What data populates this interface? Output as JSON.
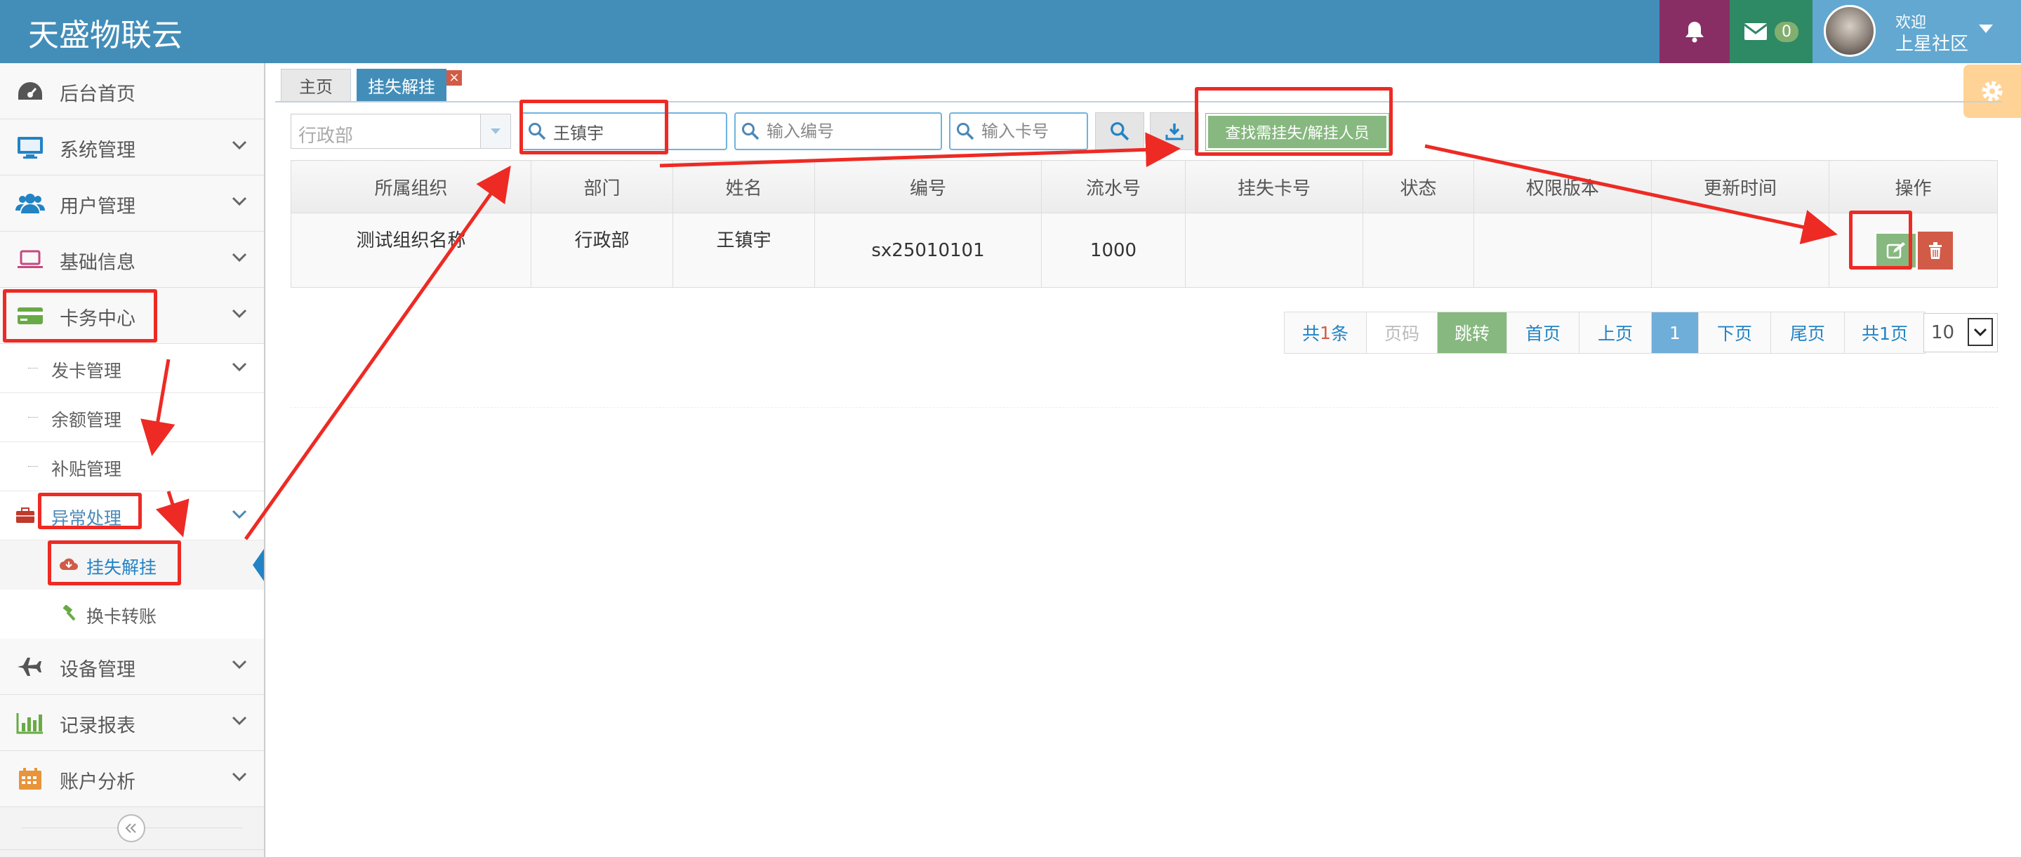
{
  "app": {
    "brand": "天盛物联云"
  },
  "header": {
    "mail_count": "0",
    "welcome": "欢迎",
    "username": "上星社区"
  },
  "sidebar": {
    "items": [
      {
        "label": "后台首页",
        "icon": "dashboard-icon"
      },
      {
        "label": "系统管理",
        "icon": "desktop-icon"
      },
      {
        "label": "用户管理",
        "icon": "users-icon"
      },
      {
        "label": "基础信息",
        "icon": "laptop-icon"
      },
      {
        "label": "卡务中心",
        "icon": "credit-card-icon"
      },
      {
        "label": "设备管理",
        "icon": "plane-icon"
      },
      {
        "label": "记录报表",
        "icon": "bar-chart-icon"
      },
      {
        "label": "账户分析",
        "icon": "calendar-icon"
      }
    ],
    "card_sub": [
      {
        "label": "发卡管理"
      },
      {
        "label": "余额管理"
      },
      {
        "label": "补贴管理"
      },
      {
        "label": "异常处理"
      }
    ],
    "exception_sub": [
      {
        "label": "挂失解挂"
      },
      {
        "label": "换卡转账"
      }
    ]
  },
  "tabs": [
    {
      "label": "主页"
    },
    {
      "label": "挂失解挂"
    }
  ],
  "toolbar": {
    "department_value": "行政部",
    "name_value": "王镇宇",
    "number_placeholder": "输入编号",
    "card_placeholder": "输入卡号",
    "find_button": "查找需挂失/解挂人员"
  },
  "table": {
    "columns": [
      "所属组织",
      "部门",
      "姓名",
      "编号",
      "流水号",
      "挂失卡号",
      "状态",
      "权限版本",
      "更新时间",
      "操作"
    ],
    "rows": [
      [
        "测试组织名称",
        "行政部",
        "王镇宇",
        "sx25010101",
        "1000",
        "",
        "",
        "",
        ""
      ]
    ]
  },
  "pagination": {
    "total_prefix": "共",
    "total_count": "1",
    "total_suffix": "条",
    "page_input_placeholder": "页码",
    "jump": "跳转",
    "first": "首页",
    "prev": "上页",
    "current": "1",
    "next": "下页",
    "last": "尾页",
    "pages": "共1页",
    "page_size": "10"
  },
  "colors": {
    "header": "#438eb9",
    "bell": "#892e65",
    "mail": "#2e8965",
    "user": "#62a8d1",
    "success": "#87b87f",
    "danger": "#d15b47",
    "annotation": "#ee2a24"
  }
}
